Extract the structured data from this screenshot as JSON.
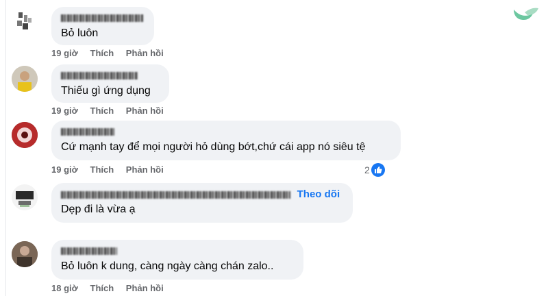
{
  "labels": {
    "like": "Thích",
    "reply": "Phản hồi",
    "follow": "Theo dõi"
  },
  "comments": [
    {
      "time": "19 giờ",
      "text": "Bỏ luôn"
    },
    {
      "time": "19 giờ",
      "text": "Thiếu gì ứng dụng"
    },
    {
      "time": "19 giờ",
      "text": "Cứ mạnh tay để mọi người hỏ dùng bớt,chứ cái app nó siêu tệ",
      "reactions": "2"
    },
    {
      "time": "19 giờ",
      "text": "Dẹp đi là vừa ạ"
    },
    {
      "time": "18 giờ",
      "text": "Bỏ luôn k dung, càng ngày càng chán zalo.."
    }
  ],
  "colors": {
    "bubble": "#f0f2f5",
    "meta": "#65676b",
    "link": "#1877f2",
    "logo": "#6cc7a0"
  }
}
